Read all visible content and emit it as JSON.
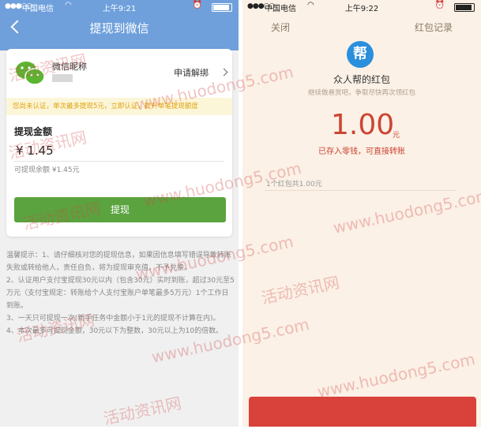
{
  "left": {
    "status": {
      "carrier": "中国电信",
      "time": "上午9:21"
    },
    "header": {
      "title": "提现到微信"
    },
    "account": {
      "nickname": "微信昵称",
      "unbind_label": "申请解绑"
    },
    "notice": "您尚未认证，单次最多提现5元，立即认证，提升单笔提现额度",
    "amount": {
      "label": "提现金额",
      "value": "¥ 1.45",
      "available": "可提现余额 ¥1.45元"
    },
    "withdraw_button": "提现",
    "tips": [
      "温馨提示：1、请仔细核对您的提现信息，如果因信息填写错误导致转账失败或转给他人，责任自负，将为提现审充值，不予兑换。",
      "2、认证用户支付宝提现30元以内（包含30元）实时到账，超过30元至5万元（支付宝规定：转账给个人支付宝账户单笔最多5万元）1个工作日到账。",
      "3、一天只可提现一次(新手任务中金额小于1元的提现不计算在内)。",
      "4、本次最多可提现金额，30元以下为整数，30元以上为10的倍数。"
    ]
  },
  "right": {
    "status": {
      "carrier": "中国电信",
      "time": "上午9:22"
    },
    "close_label": "关闭",
    "records_label": "红包记录",
    "logo_char": "帮",
    "title": "众人帮的红包",
    "subtitle": "继续做悬赏吧，争取尽快再次领红包",
    "amount": "1.00",
    "unit": "元",
    "stored_text": "已存入零钱，可直接转账",
    "count_text": "1个红包共1.00元"
  },
  "watermark": {
    "cn": "活动资讯网",
    "url": "www.huodong5.com"
  },
  "colors": {
    "header_blue": "#6fa0dc",
    "button_green": "#5aa33e",
    "red_accent": "#cc4433"
  }
}
